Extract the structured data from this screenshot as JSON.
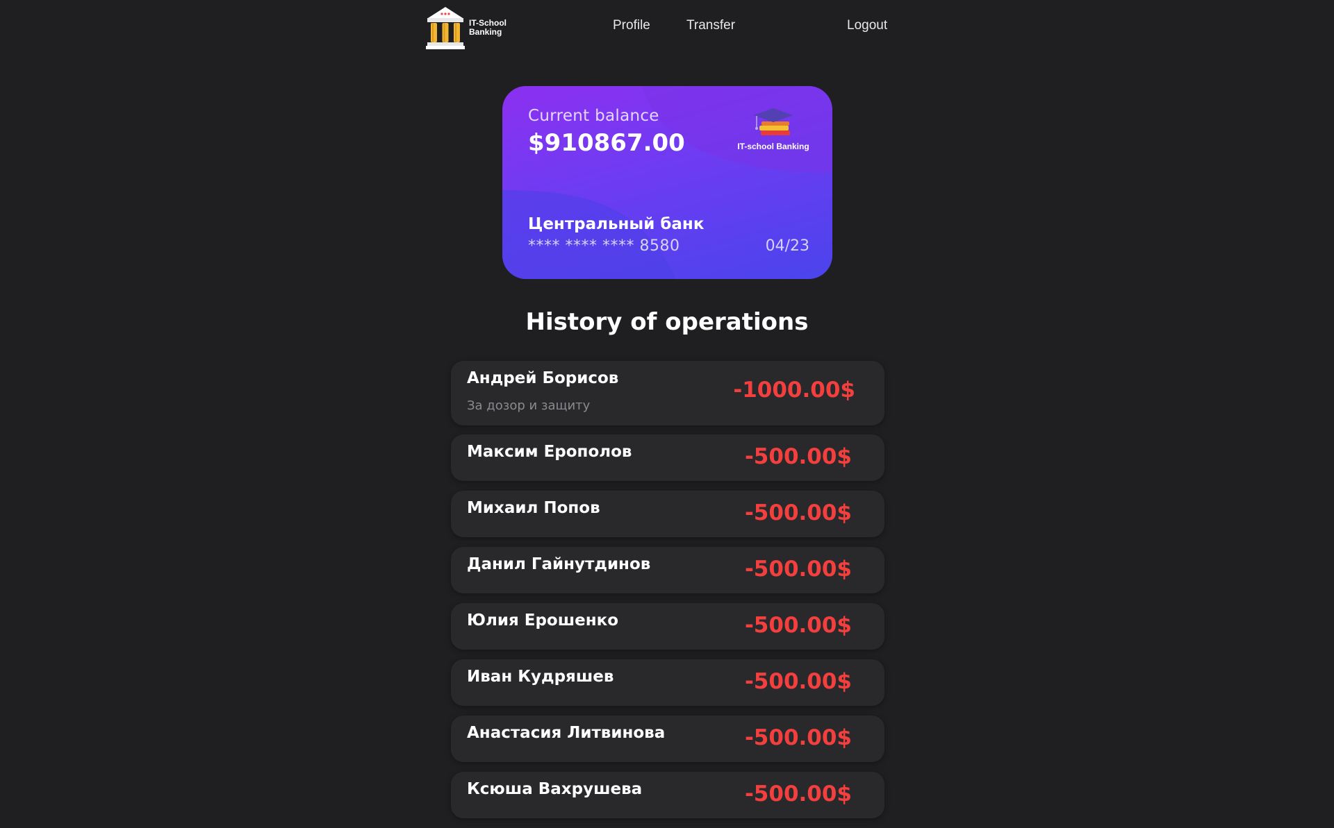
{
  "header": {
    "logo_text": "IT-School\nBanking",
    "nav": {
      "profile": "Profile",
      "transfer": "Transfer",
      "logout": "Logout"
    }
  },
  "card": {
    "balance_label": "Current balance",
    "balance": "$910867.00",
    "brand": "IT-school Banking",
    "bank_name": "Центральный банк",
    "number": "**** **** **** 8580",
    "expiry": "04/23"
  },
  "history": {
    "title": "History of operations",
    "operations": [
      {
        "name": "Андрей Борисов",
        "description": "За дозор и защиту",
        "amount": "-1000.00$"
      },
      {
        "name": "Максим Ерополов",
        "amount": "-500.00$"
      },
      {
        "name": "Михаил Попов",
        "amount": "-500.00$"
      },
      {
        "name": "Данил Гайнутдинов",
        "amount": "-500.00$"
      },
      {
        "name": "Юлия Ерошенко",
        "amount": "-500.00$"
      },
      {
        "name": "Иван Кудряшев",
        "amount": "-500.00$"
      },
      {
        "name": "Анастасия Литвинова",
        "amount": "-500.00$"
      },
      {
        "name": "Ксюша Вахрушева",
        "amount": "-500.00$"
      }
    ]
  },
  "colors": {
    "background": "#1f1f21",
    "card_gradient_start": "#8c30f0",
    "card_gradient_end": "#4a44ec",
    "operation_bg": "#29292c",
    "negative_amount": "#f3403f"
  },
  "icons": {
    "logo": "bank-building-icon",
    "card_brand": "graduation-cap-books-icon"
  }
}
